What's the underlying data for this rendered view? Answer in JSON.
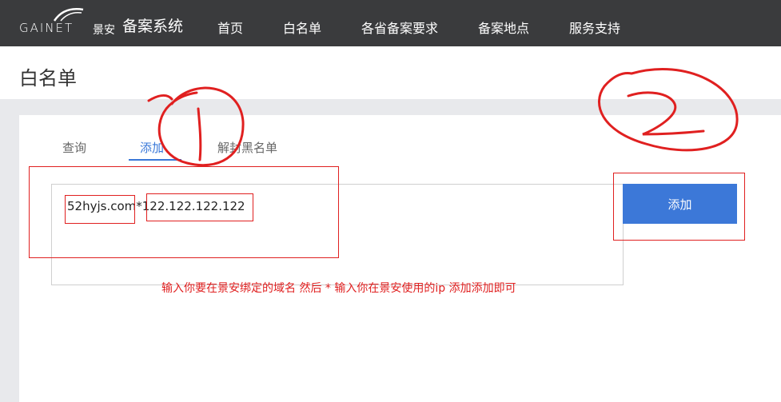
{
  "header": {
    "logo_brand": "GAINET",
    "logo_cn": "景安",
    "system_title": "备案系统",
    "nav": [
      "首页",
      "白名单",
      "各省备案要求",
      "备案地点",
      "服务支持"
    ]
  },
  "page": {
    "title": "白名单"
  },
  "tabs": [
    "查询",
    "添加",
    "解封黑名单"
  ],
  "form": {
    "domain": "52hyjs.com",
    "separator": "*",
    "ip": "122.122.122.122",
    "add_button": "添加"
  },
  "annotation": {
    "hint": "输入你要在景安绑定的域名 然后 * 输入你在景安使用的ip 添加添加即可"
  },
  "colors": {
    "accent": "#3c78d8",
    "header_bg": "#3a3b3d",
    "annotation": "#e02020"
  }
}
